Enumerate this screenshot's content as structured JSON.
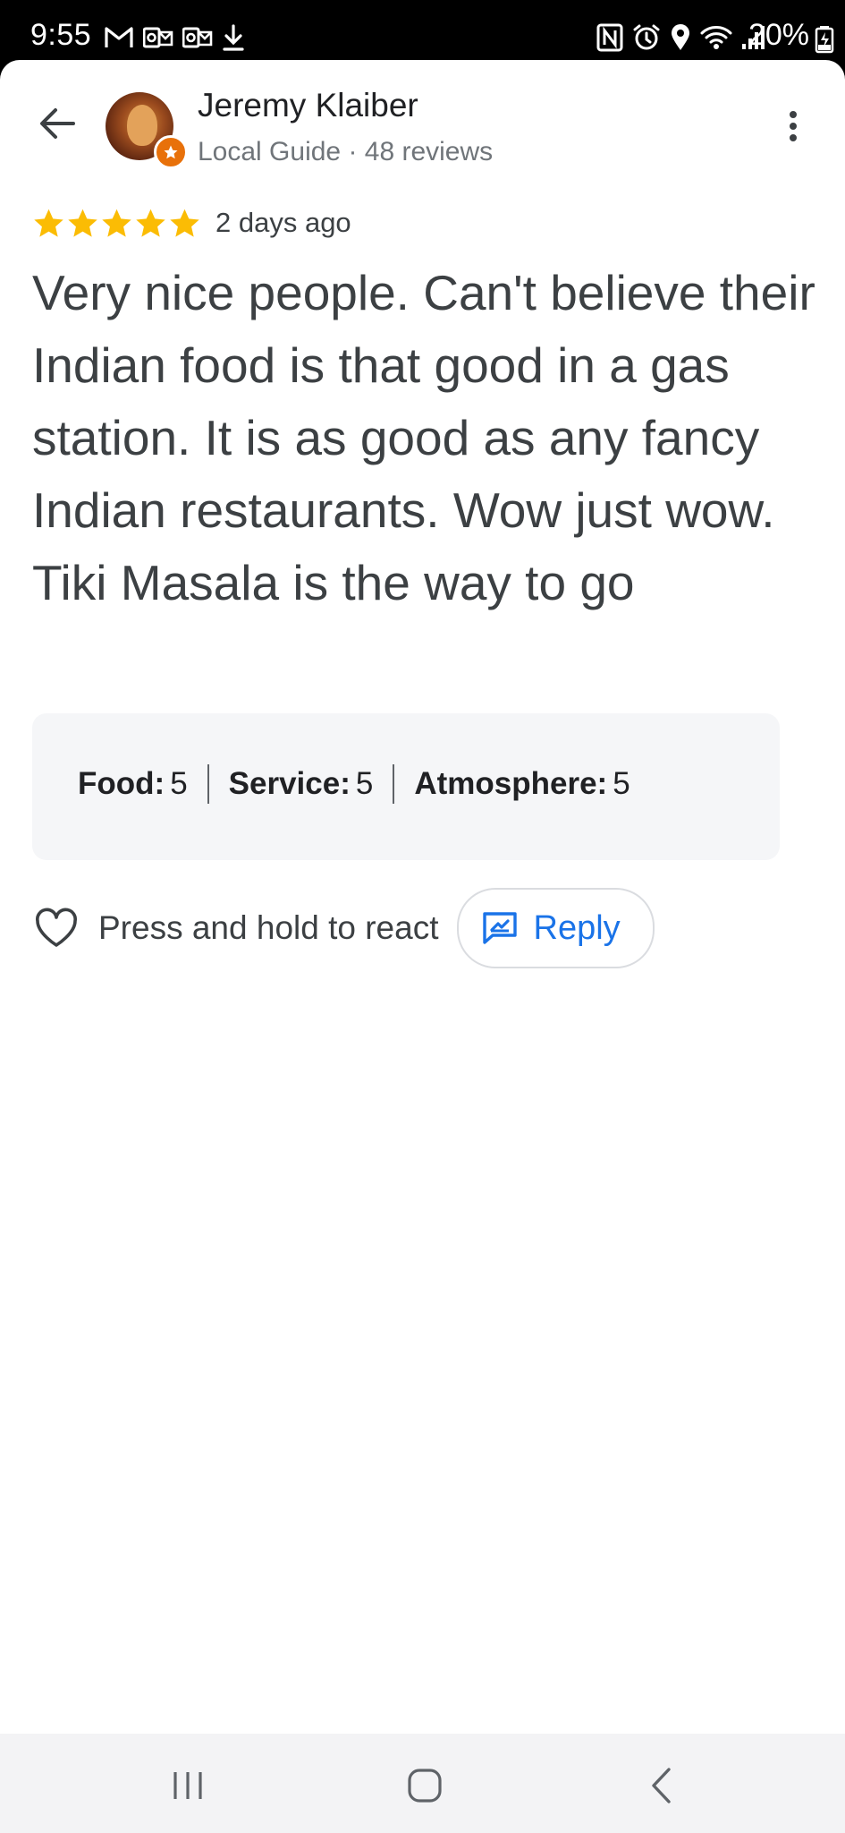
{
  "status_bar": {
    "time": "9:55",
    "battery_percent": "20%",
    "left_icons": [
      "gmail-icon",
      "outlook-icon",
      "outlook-icon",
      "download-icon"
    ],
    "right_icons": [
      "nfc-icon",
      "alarm-icon",
      "location-icon",
      "wifi-icon",
      "signal-icon",
      "battery-icon"
    ]
  },
  "header": {
    "reviewer_name": "Jeremy Klaiber",
    "reviewer_meta": "Local Guide · 48 reviews"
  },
  "review": {
    "rating": 5,
    "max_rating": 5,
    "date": "2 days ago",
    "text": "Very nice people. Can't believe their Indian food is that good in a gas station. It is as good as any fancy Indian restaurants. Wow just wow. Tiki Masala is the way to go"
  },
  "sub_ratings": [
    {
      "label": "Food:",
      "value": "5"
    },
    {
      "label": "Service:",
      "value": "5"
    },
    {
      "label": "Atmosphere:",
      "value": "5"
    }
  ],
  "actions": {
    "react_label": "Press and hold to react",
    "reply_label": "Reply"
  },
  "colors": {
    "star": "#fbbc04",
    "reply_blue": "#1a73e8",
    "local_guide_badge": "#e8710a"
  }
}
